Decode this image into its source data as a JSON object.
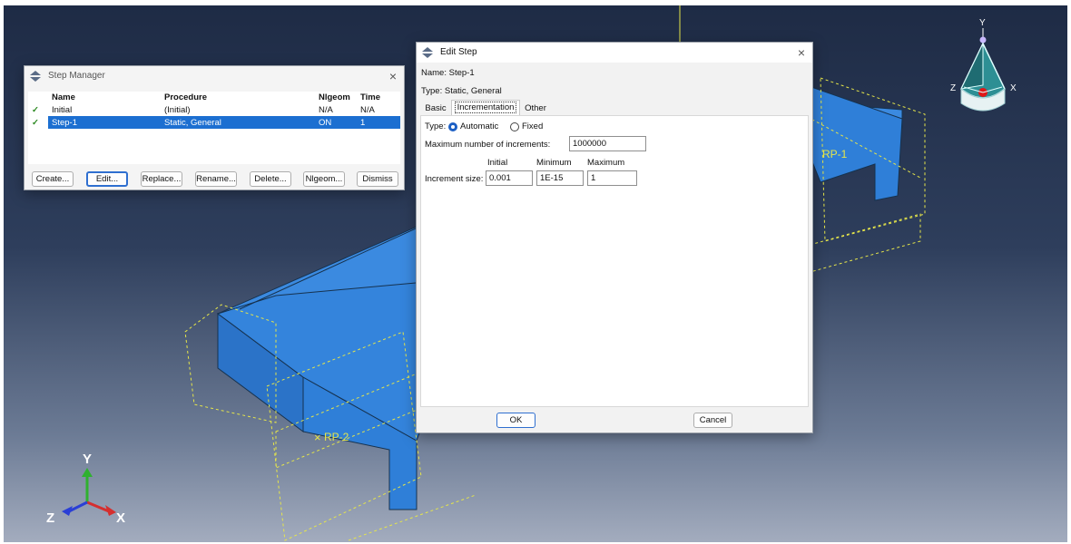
{
  "viewport": {
    "rp_labels": [
      "RP-1",
      "RP-2"
    ],
    "view_cube": {
      "y": "Y",
      "z": "Z",
      "x": "X"
    },
    "triad": {
      "y": "Y",
      "z": "Z",
      "x": "X"
    }
  },
  "step_manager": {
    "title": "Step Manager",
    "columns": [
      "Name",
      "Procedure",
      "Nlgeom",
      "Time"
    ],
    "rows": [
      {
        "check": "✓",
        "name": "Initial",
        "procedure": "(Initial)",
        "nlgeom": "N/A",
        "time": "N/A",
        "selected": false
      },
      {
        "check": "✓",
        "name": "Step-1",
        "procedure": "Static, General",
        "nlgeom": "ON",
        "time": "1",
        "selected": true
      }
    ],
    "buttons": {
      "create": "Create...",
      "edit": "Edit...",
      "replace": "Replace...",
      "rename": "Rename...",
      "delete": "Delete...",
      "nlgeom": "Nlgeom...",
      "dismiss": "Dismiss"
    }
  },
  "edit_step": {
    "title": "Edit Step",
    "name_line": "Name: Step-1",
    "type_line": "Type: Static, General",
    "tabs": [
      "Basic",
      "Incrementation",
      "Other"
    ],
    "active_tab": "Incrementation",
    "type_label": "Type:",
    "type_options": [
      "Automatic",
      "Fixed"
    ],
    "type_selected": "Automatic",
    "max_increments_label": "Maximum number of increments:",
    "max_increments_value": "1000000",
    "increment_headers": [
      "Initial",
      "Minimum",
      "Maximum"
    ],
    "increment_size_label": "Increment size:",
    "increment_values": {
      "initial": "0.001",
      "minimum": "1E-15",
      "maximum": "1"
    },
    "ok_label": "OK",
    "cancel_label": "Cancel"
  },
  "colors": {
    "part_blue": "#2f7fd8",
    "selection_blue": "#1c6fd1",
    "wire_yellow": "#e6e64a"
  }
}
